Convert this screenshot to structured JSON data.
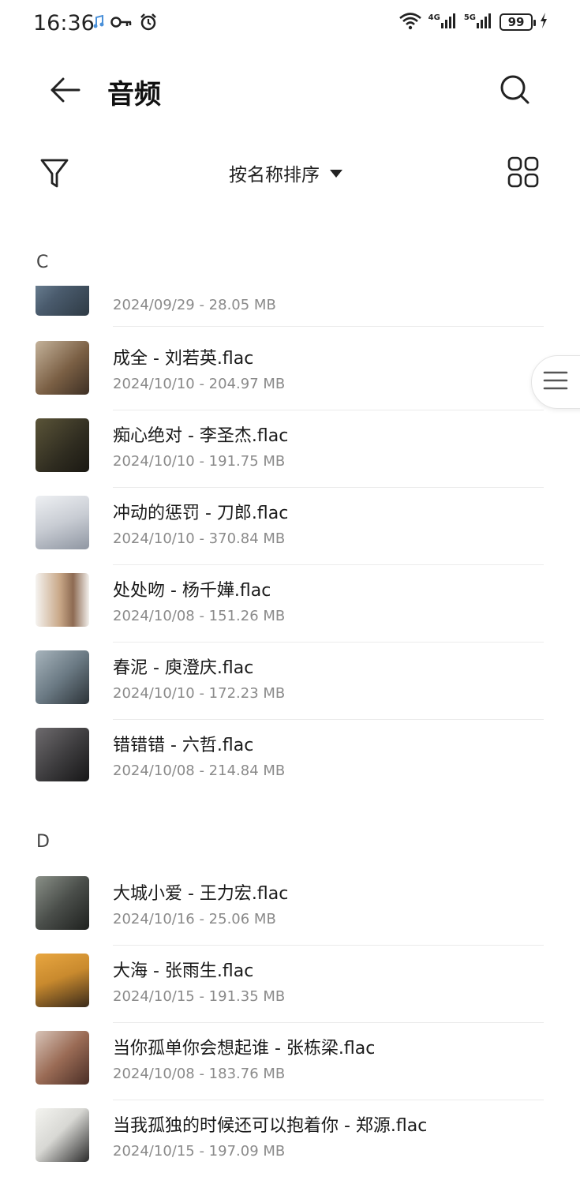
{
  "status_bar": {
    "time": "16:36",
    "net1": "4G",
    "net2": "5G",
    "battery": "99"
  },
  "header": {
    "title": "音频"
  },
  "sort": {
    "label": "按名称排序"
  },
  "sections": [
    {
      "letter": "C",
      "items": [
        {
          "title": "",
          "meta": "2024/09/29 - 28.05 MB",
          "thumb_color": "#5c6f85"
        },
        {
          "title": "成全 - 刘若英.flac",
          "meta": "2024/10/10 - 204.97 MB",
          "thumb_color": "#8a7256"
        },
        {
          "title": "痴心绝对 - 李圣杰.flac",
          "meta": "2024/10/10 - 191.75 MB",
          "thumb_color": "#3e3a2c"
        },
        {
          "title": "冲动的惩罚 - 刀郎.flac",
          "meta": "2024/10/10 - 370.84 MB",
          "thumb_color": "#c8ccd3"
        },
        {
          "title": "处处吻 - 杨千嬅.flac",
          "meta": "2024/10/08 - 151.26 MB",
          "thumb_color": "#b89c80"
        },
        {
          "title": "春泥 - 庾澄庆.flac",
          "meta": "2024/10/10 - 172.23 MB",
          "thumb_color": "#6b7a84"
        },
        {
          "title": "错错错 - 六哲.flac",
          "meta": "2024/10/08 - 214.84 MB",
          "thumb_color": "#3b3a3c"
        }
      ]
    },
    {
      "letter": "D",
      "items": [
        {
          "title": "大城小爱 - 王力宏.flac",
          "meta": "2024/10/16 - 25.06 MB",
          "thumb_color": "#4a4e4a"
        },
        {
          "title": "大海 - 张雨生.flac",
          "meta": "2024/10/15 - 191.35 MB",
          "thumb_color": "#c98a2e"
        },
        {
          "title": "当你孤单你会想起谁 - 张栋梁.flac",
          "meta": "2024/10/08 - 183.76 MB",
          "thumb_color": "#9a6b55"
        },
        {
          "title": "当我孤独的时候还可以抱着你 - 郑源.flac",
          "meta": "2024/10/15 - 197.09 MB",
          "thumb_color": "#d8d8d4"
        }
      ]
    }
  ]
}
